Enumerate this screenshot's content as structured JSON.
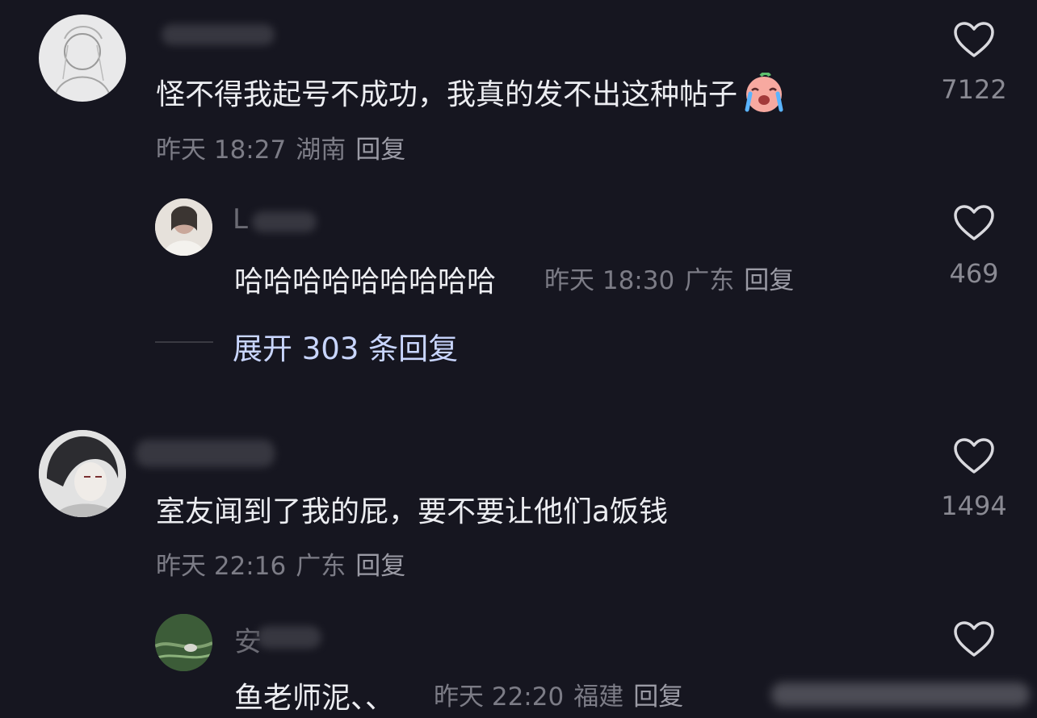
{
  "comments": [
    {
      "text": "怪不得我起号不成功，我真的发不出这种帖子",
      "time": "昨天 18:27",
      "location": "湖南",
      "reply_label": "回复",
      "likes": "7122",
      "emoji": "crying-face"
    },
    {
      "text": "哈哈哈哈哈哈哈哈哈",
      "time": "昨天 18:30",
      "location": "广东",
      "reply_label": "回复",
      "likes": "469",
      "name_initial": "L"
    },
    {
      "text": "室友闻到了我的屁，要不要让他们a饭钱",
      "time": "昨天 22:16",
      "location": "广东",
      "reply_label": "回复",
      "likes": "1494"
    },
    {
      "text": "鱼老师泥、、",
      "time": "昨天 22:20",
      "location": "福建",
      "reply_label": "回复",
      "name_initial": "安"
    }
  ],
  "expand_replies": "展开 303 条回复",
  "colors": {
    "background": "#161620",
    "text": "#ecedf1",
    "meta": "#7c7c86",
    "expand_link": "#c9d6ff"
  }
}
